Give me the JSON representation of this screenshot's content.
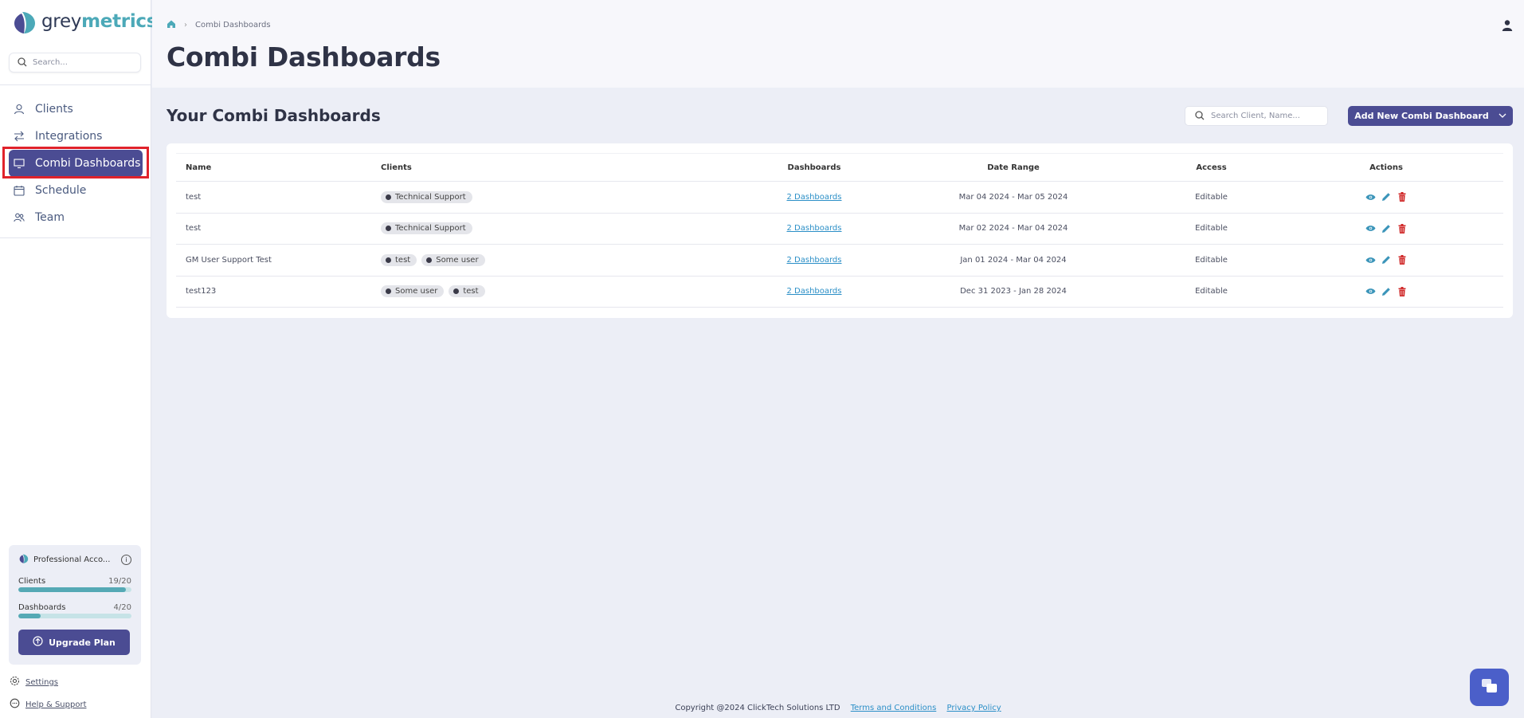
{
  "app": {
    "logo_grey": "grey",
    "logo_metrics": "metrics",
    "brand_color": "#4b4c93",
    "accent_color": "#4ca9b8"
  },
  "sidebar": {
    "search_placeholder": "Search...",
    "items": [
      {
        "label": "Clients",
        "icon": "user-icon"
      },
      {
        "label": "Integrations",
        "icon": "arrows-icon"
      },
      {
        "label": "Combi Dashboards",
        "icon": "monitor-icon",
        "active": true
      },
      {
        "label": "Schedule",
        "icon": "calendar-icon"
      },
      {
        "label": "Team",
        "icon": "team-icon"
      }
    ],
    "plan": {
      "name": "Professional Acco...",
      "clients_label": "Clients",
      "clients_count": "19/20",
      "clients_fraction": 0.95,
      "dashboards_label": "Dashboards",
      "dashboards_count": "4/20",
      "dashboards_fraction": 0.2,
      "upgrade_label": "Upgrade Plan"
    },
    "settings_label": "Settings",
    "help_label": "Help & Support"
  },
  "header": {
    "breadcrumb": "Combi Dashboards",
    "title": "Combi Dashboards"
  },
  "main": {
    "section_title": "Your Combi Dashboards",
    "search_placeholder": "Search Client, Name...",
    "add_button": "Add New Combi Dashboard",
    "columns": [
      "Name",
      "Clients",
      "Dashboards",
      "Date Range",
      "Access",
      "Actions"
    ],
    "rows": [
      {
        "name": "test",
        "clients": [
          "Technical Support"
        ],
        "dashboards": "2 Dashboards",
        "date_range": "Mar 04 2024 - Mar 05 2024",
        "access": "Editable"
      },
      {
        "name": "test",
        "clients": [
          "Technical Support"
        ],
        "dashboards": "2 Dashboards",
        "date_range": "Mar 02 2024 - Mar 04 2024",
        "access": "Editable"
      },
      {
        "name": "GM User Support Test",
        "clients": [
          "test",
          "Some user"
        ],
        "dashboards": "2 Dashboards",
        "date_range": "Jan 01 2024 - Mar 04 2024",
        "access": "Editable"
      },
      {
        "name": "test123",
        "clients": [
          "Some user",
          "test"
        ],
        "dashboards": "2 Dashboards",
        "date_range": "Dec 31 2023 - Jan 28 2024",
        "access": "Editable"
      }
    ]
  },
  "footer": {
    "copyright": "Copyright @2024 ClickTech Solutions LTD",
    "terms": "Terms and Conditions",
    "privacy": "Privacy Policy"
  }
}
